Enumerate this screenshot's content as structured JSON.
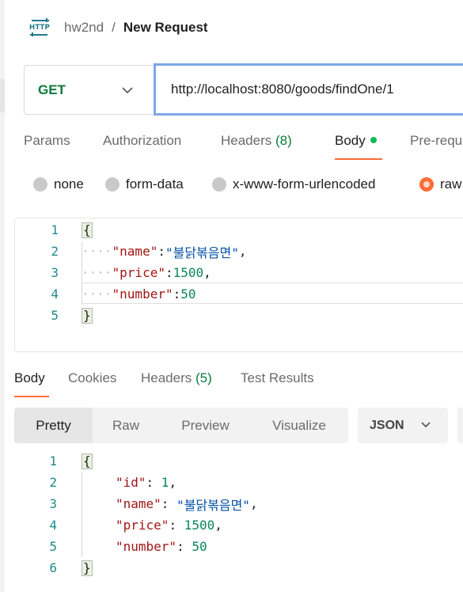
{
  "header": {
    "icon": "http-icon",
    "icon_text": "HTTP",
    "collection": "hw2nd",
    "separator": "/",
    "title": "New Request"
  },
  "request": {
    "method": "GET",
    "url": "http://localhost:8080/goods/findOne/1"
  },
  "request_tabs": [
    {
      "label": "Params"
    },
    {
      "label": "Authorization"
    },
    {
      "label": "Headers",
      "count": "(8)"
    },
    {
      "label": "Body",
      "active": true
    },
    {
      "label": "Pre-requ"
    }
  ],
  "body_types": [
    {
      "label": "none",
      "selected": false
    },
    {
      "label": "form-data",
      "selected": false
    },
    {
      "label": "x-www-form-urlencoded",
      "selected": false
    },
    {
      "label": "raw",
      "selected": true
    }
  ],
  "request_body": {
    "line_numbers": [
      "1",
      "2",
      "3",
      "4",
      "5"
    ],
    "open_brace": "{",
    "close_brace": "}",
    "indent_dots": "····",
    "fields": [
      {
        "key": "\"name\"",
        "colon": ":",
        "value": "\"불닭볶음면\"",
        "trail": ",",
        "kind": "str"
      },
      {
        "key": "\"price\"",
        "colon": ":",
        "value": "1500",
        "trail": ",",
        "kind": "num"
      },
      {
        "key": "\"number\"",
        "colon": ":",
        "value": "50",
        "trail": "",
        "kind": "num"
      }
    ]
  },
  "response_tabs": [
    {
      "label": "Body",
      "active": true
    },
    {
      "label": "Cookies"
    },
    {
      "label": "Headers",
      "count": "(5)"
    },
    {
      "label": "Test Results"
    }
  ],
  "response_views": [
    {
      "label": "Pretty",
      "active": true
    },
    {
      "label": "Raw"
    },
    {
      "label": "Preview"
    },
    {
      "label": "Visualize"
    }
  ],
  "response_format": "JSON",
  "response_body": {
    "line_numbers": [
      "1",
      "2",
      "3",
      "4",
      "5",
      "6"
    ],
    "open_brace": "{",
    "close_brace": "}",
    "fields": [
      {
        "key": "\"id\"",
        "colon": ": ",
        "value": "1",
        "trail": ",",
        "kind": "num"
      },
      {
        "key": "\"name\"",
        "colon": ": ",
        "value": "\"불닭볶음면\"",
        "trail": ",",
        "kind": "str"
      },
      {
        "key": "\"price\"",
        "colon": ": ",
        "value": "1500",
        "trail": ",",
        "kind": "num"
      },
      {
        "key": "\"number\"",
        "colon": ": ",
        "value": "50",
        "trail": "",
        "kind": "num"
      }
    ]
  },
  "colors": {
    "accent": "#ff6c37",
    "method_get": "#0b7a3b",
    "url_focus": "#7da7e6",
    "active_dot": "#0cbb52"
  }
}
